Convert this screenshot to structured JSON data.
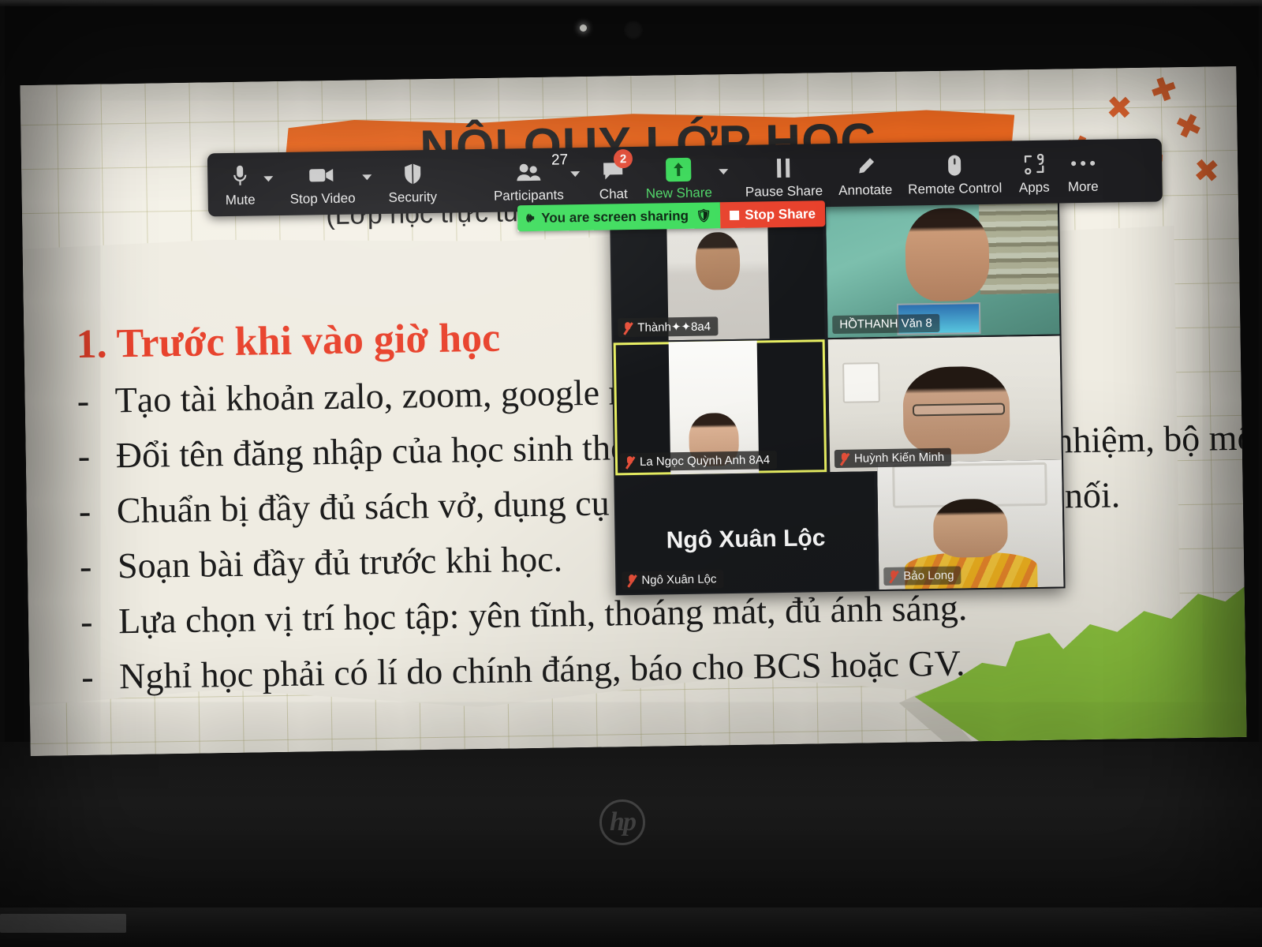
{
  "device": {
    "brand_logo": "hp",
    "webcam_led": "webcam-led-indicator"
  },
  "zoom_toolbar": {
    "items": [
      {
        "label": "Mute",
        "icon": "microphone-icon",
        "has_caret": true
      },
      {
        "label": "Stop Video",
        "icon": "video-camera-icon",
        "has_caret": true
      },
      {
        "label": "Security",
        "icon": "shield-icon",
        "has_caret": false
      },
      {
        "label": "Participants",
        "icon": "people-icon",
        "has_caret": true,
        "count": "27"
      },
      {
        "label": "Chat",
        "icon": "chat-bubble-icon",
        "has_caret": false,
        "badge": "2"
      },
      {
        "label": "New Share",
        "icon": "share-up-arrow-icon",
        "has_caret": true,
        "highlight": true
      },
      {
        "label": "Pause Share",
        "icon": "pause-icon",
        "has_caret": false
      },
      {
        "label": "Annotate",
        "icon": "pencil-icon",
        "has_caret": false
      },
      {
        "label": "Remote Control",
        "icon": "mouse-icon",
        "has_caret": false
      },
      {
        "label": "Apps",
        "icon": "apps-icon",
        "has_caret": false
      },
      {
        "label": "More",
        "icon": "ellipsis-icon",
        "has_caret": false
      }
    ],
    "accent_green": "#3ddc5c",
    "accent_red": "#e8412c",
    "badge_red": "#e8503a",
    "bar_background": "#1f1f22"
  },
  "share_status": {
    "sharing_text": "You are screen sharing",
    "shield_icon": "shield-check-icon",
    "sound_icon": "sound-wave-icon",
    "stop_label": "Stop Share"
  },
  "slide": {
    "banner_title": "NỘI QUY LỚP HỌC",
    "banner_subtitle": "(Lớp học trực tuyến qua ứng dụng zoom, google meet)",
    "heading": "1.  Trước khi vào giờ học",
    "banner_color": "#f26b21",
    "heading_color": "#e8402a",
    "accent_green": "#21a14a",
    "accent_light_green": "#8dc63f",
    "bullet_marker": "-",
    "bullets": [
      "Tạo tài khoản zalo, zoom, google meet.",
      "Đổi tên đăng nhập của học sinh theo quy định của giáo viên chủ nhiệm, bộ môn để tiện theo dõi.",
      "Chuẩn bị đầy đủ sách vở, dụng cụ học tập, thiết bị học tập có kết nối.",
      "Soạn bài đầy đủ trước khi học.",
      "Lựa chọn vị trí học tập: yên tĩnh, thoáng mát, đủ ánh sáng.",
      "Nghỉ học phải có lí do chính đáng, báo cho BCS hoặc GV."
    ],
    "decoration_x_marks": 6
  },
  "video_panel": {
    "active_speaker_border": "#e7ee62",
    "panel_background": "#1b1d21",
    "big_name_overlay": "Ngô Xuân Lộc",
    "tiles": [
      {
        "name": "Thành✦✦8a4",
        "muted": true,
        "active": false,
        "video_on": true
      },
      {
        "name": "HỒTHANH Văn 8",
        "muted": false,
        "active": false,
        "video_on": true
      },
      {
        "name": "La Ngọc Quỳnh Anh 8A4",
        "muted": true,
        "active": true,
        "video_on": true
      },
      {
        "name": "Huỳnh Kiến Minh",
        "muted": true,
        "active": false,
        "video_on": true
      },
      {
        "name": "Ngô Xuân Lộc",
        "muted": true,
        "active": false,
        "video_on": false
      },
      {
        "name": "Bảo Long",
        "muted": true,
        "active": false,
        "video_on": true
      }
    ]
  }
}
